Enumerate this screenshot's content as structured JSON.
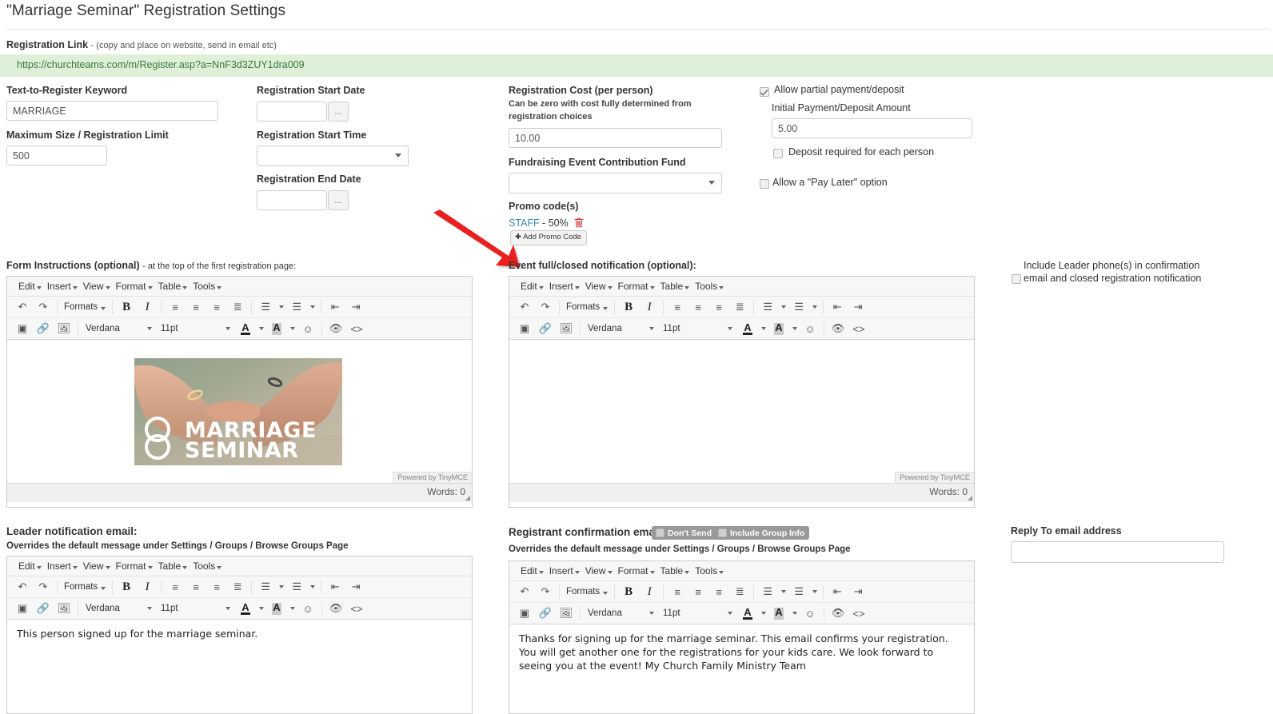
{
  "header": {
    "title": "\"Marriage Seminar\" Registration Settings"
  },
  "registration_link": {
    "label": "Registration Link",
    "note": "- (copy and place on website, send in email etc)",
    "url": "https://churchteams.com/m/Register.asp?a=NnF3d3ZUY1dra009"
  },
  "left_fields": {
    "keyword_label": "Text-to-Register Keyword",
    "keyword_value": "MARRIAGE",
    "max_size_label": "Maximum Size / Registration Limit",
    "max_size_value": "500"
  },
  "date_fields": {
    "start_date_label": "Registration Start Date",
    "start_date_value": "",
    "start_time_label": "Registration Start Time",
    "start_time_value": "",
    "end_date_label": "Registration End Date",
    "end_date_value": "",
    "picker_button_label": "..."
  },
  "cost": {
    "label": "Registration Cost (per person)",
    "hint_line1": "Can be zero with cost fully determined from",
    "hint_line2": "registration choices",
    "value": "10.00",
    "fund_label": "Fundraising Event Contribution Fund",
    "fund_value": "",
    "promo_label": "Promo code(s)",
    "promo_code": "STAFF",
    "promo_discount": "- 50%",
    "add_promo_label": "Add Promo Code"
  },
  "payment": {
    "allow_partial_label": "Allow partial payment/deposit",
    "allow_partial_checked": true,
    "initial_amount_label": "Initial Payment/Deposit Amount",
    "initial_amount_value": "5.00",
    "deposit_each_label": "Deposit required for each person",
    "deposit_each_checked": false,
    "pay_later_label": "Allow a \"Pay Later\" option",
    "pay_later_checked": false
  },
  "leader_phone": {
    "line1": "Include Leader phone(s) in confirmation",
    "line2": "email and closed registration notification",
    "checked": false
  },
  "editor_common": {
    "menu": [
      "Edit",
      "Insert",
      "View",
      "Format",
      "Table",
      "Tools"
    ],
    "formats_label": "Formats",
    "font_family": "Verdana",
    "font_size": "11pt",
    "branding": "Powered by TinyMCE",
    "words_label": "Words: 0"
  },
  "form_instructions": {
    "label": "Form Instructions (optional)",
    "note": "- at the top of the first registration page:",
    "image_line1": "MARRIAGE",
    "image_line2": "SEMINAR"
  },
  "event_full": {
    "label": "Event full/closed notification (optional):",
    "content": ""
  },
  "leader_notification": {
    "label": "Leader notification email:",
    "overrides": "Overrides the default message under Settings / Groups / Browse Groups Page",
    "content": "This person signed up for the marriage seminar."
  },
  "registrant_confirmation": {
    "label": "Registrant confirmation email:",
    "badge_dont_send": "Don't Send",
    "badge_include_group": "Include Group Info",
    "overrides": "Overrides the default message under Settings / Groups / Browse Groups Page",
    "content": "Thanks for signing up for the marriage seminar. This email confirms your registration. You will get another one for the registrations for your kids care. We look forward to seeing you at the event! My Church Family Ministry Team"
  },
  "reply_to": {
    "label": "Reply To email address",
    "value": ""
  },
  "colors": {
    "link_bar_bg": "#dff0d8",
    "link_text": "#3c763d",
    "promo_link": "#3a87ad",
    "arrow": "#e8201f",
    "badge_bg": "#999999"
  }
}
